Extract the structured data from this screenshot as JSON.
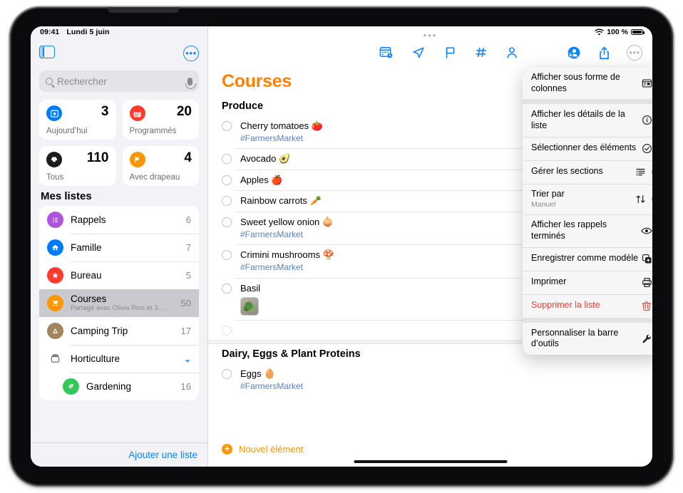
{
  "status_bar": {
    "time": "09:41",
    "date": "Lundi 5 juin",
    "battery": "100 %"
  },
  "sidebar": {
    "search_placeholder": "Rechercher",
    "search_value": "",
    "smart_cards": [
      {
        "count": "3",
        "label": "Aujourd’hui",
        "icon": "today-icon",
        "color": "#007aff"
      },
      {
        "count": "20",
        "label": "Programmés",
        "icon": "scheduled-icon",
        "color": "#ff3b30"
      },
      {
        "count": "110",
        "label": "Tous",
        "icon": "all-icon",
        "color": "#1c1c1e"
      },
      {
        "count": "4",
        "label": "Avec drapeau",
        "icon": "flag-icon",
        "color": "#ff9500"
      }
    ],
    "my_lists_title": "Mes listes",
    "lists": [
      {
        "name": "Rappels",
        "subtitle": "",
        "count": "6",
        "color": "#af52de",
        "icon": "list-bullet-icon"
      },
      {
        "name": "Famille",
        "subtitle": "",
        "count": "7",
        "color": "#007aff",
        "icon": "house-icon"
      },
      {
        "name": "Bureau",
        "subtitle": "",
        "count": "5",
        "color": "#ff3b30",
        "icon": "star-icon"
      },
      {
        "name": "Courses",
        "subtitle": "Partagé avec Olivia Rico et 3…",
        "count": "50",
        "color": "#ff9500",
        "icon": "cart-icon"
      },
      {
        "name": "Camping Trip",
        "subtitle": "",
        "count": "17",
        "color": "#a2845e",
        "icon": "tent-icon"
      },
      {
        "name": "Horticulture",
        "subtitle": "",
        "count": "",
        "color": "#ffffff",
        "icon": "folder-icon"
      },
      {
        "name": "Gardening",
        "subtitle": "",
        "count": "16",
        "color": "#34c759",
        "icon": "leaf-icon"
      }
    ],
    "add_list_label": "Ajouter une liste"
  },
  "toolbar": {
    "left_icons": [
      "calendar-clock-icon",
      "location-arrow-icon",
      "flag-icon",
      "hashtag-icon",
      "person-icon"
    ],
    "right_icons": [
      "add-person-icon",
      "share-icon",
      "more-circle-icon"
    ]
  },
  "main": {
    "title": "Courses",
    "title_color": "#ff8000",
    "new_item_label": "Nouvel élément",
    "sections": [
      {
        "title": "Produce",
        "items": [
          {
            "text": "Cherry tomatoes 🍅",
            "tag": "#FarmersMarket",
            "image": false
          },
          {
            "text": "Avocado 🥑",
            "tag": "",
            "image": false
          },
          {
            "text": "Apples 🍎",
            "tag": "",
            "image": false
          },
          {
            "text": "Rainbow carrots 🥕",
            "tag": "",
            "image": false
          },
          {
            "text": "Sweet yellow onion 🧅",
            "tag": "#FarmersMarket",
            "image": false
          },
          {
            "text": "Crimini mushrooms 🍄",
            "tag": "#FarmersMarket",
            "image": false
          },
          {
            "text": "Basil",
            "tag": "",
            "image": true
          },
          {
            "text": "",
            "tag": "",
            "image": false
          }
        ]
      },
      {
        "title": "Dairy, Eggs & Plant Proteins",
        "items": [
          {
            "text": "Eggs 🥚",
            "tag": "#FarmersMarket",
            "image": false
          }
        ]
      }
    ]
  },
  "context_menu": {
    "items": [
      {
        "label": "Afficher sous forme de colonnes",
        "sub": "",
        "icon": "columns-icon",
        "chevron": false,
        "danger": false,
        "gap_after": true
      },
      {
        "label": "Afficher les détails de la liste",
        "sub": "",
        "icon": "info-icon",
        "chevron": false,
        "danger": false,
        "gap_after": false
      },
      {
        "label": "Sélectionner des éléments",
        "sub": "",
        "icon": "checkmark-circle-icon",
        "chevron": false,
        "danger": false,
        "gap_after": false
      },
      {
        "label": "Gérer les sections",
        "sub": "",
        "icon": "sections-icon",
        "chevron": true,
        "danger": false,
        "gap_after": false
      },
      {
        "label": "Trier par",
        "sub": "Manuel",
        "icon": "sort-icon",
        "chevron": true,
        "danger": false,
        "gap_after": false
      },
      {
        "label": "Afficher les rappels terminés",
        "sub": "",
        "icon": "eye-icon",
        "chevron": false,
        "danger": false,
        "gap_after": false
      },
      {
        "label": "Enregistrer comme modèle",
        "sub": "",
        "icon": "duplicate-icon",
        "chevron": false,
        "danger": false,
        "gap_after": false
      },
      {
        "label": "Imprimer",
        "sub": "",
        "icon": "printer-icon",
        "chevron": false,
        "danger": false,
        "gap_after": false
      },
      {
        "label": "Supprimer la liste",
        "sub": "",
        "icon": "trash-icon",
        "chevron": false,
        "danger": true,
        "gap_after": true
      },
      {
        "label": "Personnaliser la barre d’outils",
        "sub": "",
        "icon": "wrench-icon",
        "chevron": false,
        "danger": false,
        "gap_after": false
      }
    ]
  }
}
